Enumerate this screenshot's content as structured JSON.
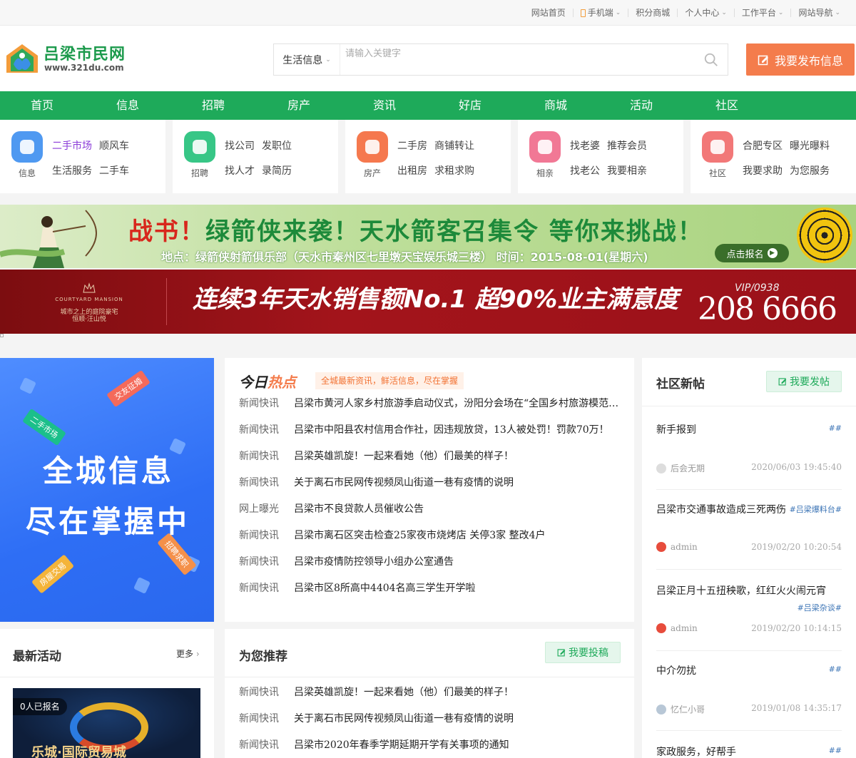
{
  "topbar": {
    "links": [
      {
        "label": "网站首页",
        "icon": "",
        "caret": false
      },
      {
        "label": "手机端",
        "icon": "phone-icon",
        "caret": true
      },
      {
        "label": "积分商城",
        "icon": "",
        "caret": false
      },
      {
        "label": "个人中心",
        "icon": "",
        "caret": true
      },
      {
        "label": "工作平台",
        "icon": "",
        "caret": true
      },
      {
        "label": "网站导航",
        "icon": "",
        "caret": true
      }
    ]
  },
  "logo": {
    "name": "吕梁市民网",
    "url": "www.321du.com"
  },
  "search": {
    "category": "生活信息",
    "placeholder": "请输入关键字",
    "value": ""
  },
  "publish_button": "我要发布信息",
  "nav": [
    "首页",
    "信息",
    "招聘",
    "房产",
    "资讯",
    "好店",
    "商城",
    "活动",
    "社区"
  ],
  "categories": [
    {
      "label": "信息",
      "icon": "info-icon",
      "color": "#3d8ef0",
      "links": [
        "二手市场",
        "顺风车",
        "生活服务",
        "二手车"
      ],
      "highlight": 0
    },
    {
      "label": "招聘",
      "icon": "briefcase-icon",
      "color": "#22c07a",
      "links": [
        "找公司",
        "发职位",
        "找人才",
        "录简历"
      ],
      "highlight": -1
    },
    {
      "label": "房产",
      "icon": "building-icon",
      "color": "#f46a3b",
      "links": [
        "二手房",
        "商铺转让",
        "出租房",
        "求租求购"
      ],
      "highlight": -1
    },
    {
      "label": "相亲",
      "icon": "heart-icon",
      "color": "#f06a8a",
      "links": [
        "找老婆",
        "推荐会员",
        "找老公",
        "我要相亲"
      ],
      "highlight": -1
    },
    {
      "label": "社区",
      "icon": "community-icon",
      "color": "#f16a6a",
      "links": [
        "合肥专区",
        "曝光曝料",
        "我要求助",
        "为您服务"
      ],
      "highlight": -1
    }
  ],
  "banner1": {
    "headline_red": "战书！",
    "headline": "绿箭侠来袭！天水箭客召集令 等你来挑战！",
    "detail": "地点：绿箭侠射箭俱乐部（天水市秦州区七里墩天宝娱乐城三楼） 时间：2015-08-01(星期六)",
    "button": "点击报名"
  },
  "banner2": {
    "brand": "COURTYARD MANSION",
    "brand_sub": "城市之上的庭院豪宅",
    "brand_name": "恒顺·汪山悦",
    "headline": "连续3年天水销售额No.1 超90%业主满意度",
    "vip": "VIP/0938",
    "phone": "208 6666"
  },
  "promo": {
    "line1": "全城信息",
    "line2": "尽在掌握中",
    "tags": [
      "二手市场",
      "交友征婚",
      "招聘求职",
      "房屋交易"
    ]
  },
  "hot": {
    "title_a": "今日",
    "title_b": "热点",
    "subtitle": "全城最新资讯，鲜活信息，尽在掌握",
    "items": [
      {
        "cat": "新闻快讯",
        "title": "吕梁市黄河人家乡村旅游季启动仪式，汾阳分会场在“全国乡村旅游模范…"
      },
      {
        "cat": "新闻快讯",
        "title": "吕梁市中阳县农村信用合作社，因违规放贷，13人被处罚！罚款70万！"
      },
      {
        "cat": "新闻快讯",
        "title": "吕梁英雄凯旋！一起来看她（他）们最美的样子！"
      },
      {
        "cat": "新闻快讯",
        "title": "关于离石市民网传视频凤山街道一巷有疫情的说明"
      },
      {
        "cat": "网上曝光",
        "title": "吕梁市不良贷款人员催收公告"
      },
      {
        "cat": "新闻快讯",
        "title": "吕梁市离石区突击检查25家夜市烧烤店 关停3家 整改4户"
      },
      {
        "cat": "新闻快讯",
        "title": "吕梁市疫情防控领导小组办公室通告"
      },
      {
        "cat": "新闻快讯",
        "title": "吕梁市区8所高中4404名高三学生开学啦"
      }
    ]
  },
  "community": {
    "title": "社区新帖",
    "post_button": "我要发帖",
    "posts": [
      {
        "title": "新手报到",
        "tag": "##",
        "author": "后会无期",
        "time": "2020/06/03 19:45:40",
        "avatar_color": "#dddddd"
      },
      {
        "title": "吕梁市交通事故造成三死两伤",
        "tag": "#吕梁爆料台#",
        "author": "admin",
        "time": "2019/02/20 10:20:54",
        "avatar_color": "#e74c3c"
      },
      {
        "title": "吕梁正月十五扭秧歌，红红火火闹元宵",
        "tag": "#吕梁杂谈#",
        "author": "admin",
        "time": "2019/02/20 10:14:15",
        "avatar_color": "#e74c3c"
      },
      {
        "title": "中介勿扰",
        "tag": "##",
        "author": "忆仁小哥",
        "time": "2019/01/08 14:35:17",
        "avatar_color": "#b8c7d6"
      },
      {
        "title": "家政服务，好帮手",
        "tag": "##",
        "author": "",
        "time": "",
        "avatar_color": "#dddddd"
      }
    ]
  },
  "activities": {
    "title": "最新活动",
    "more": "更多",
    "badge": "0人已报名",
    "caption": "乐城·国际贸易城"
  },
  "recommend": {
    "title": "为您推荐",
    "button": "我要投稿",
    "items": [
      {
        "cat": "新闻快讯",
        "title": "吕梁英雄凯旋！一起来看她（他）们最美的样子！"
      },
      {
        "cat": "新闻快讯",
        "title": "关于离石市民网传视频凤山街道一巷有疫情的说明"
      },
      {
        "cat": "新闻快讯",
        "title": "吕梁市2020年春季学期延期开学有关事项的通知"
      }
    ]
  },
  "colors": {
    "brand_green": "#1eaa5a",
    "accent_orange": "#f47c4c",
    "highlight_purple": "#8a3ad8"
  }
}
